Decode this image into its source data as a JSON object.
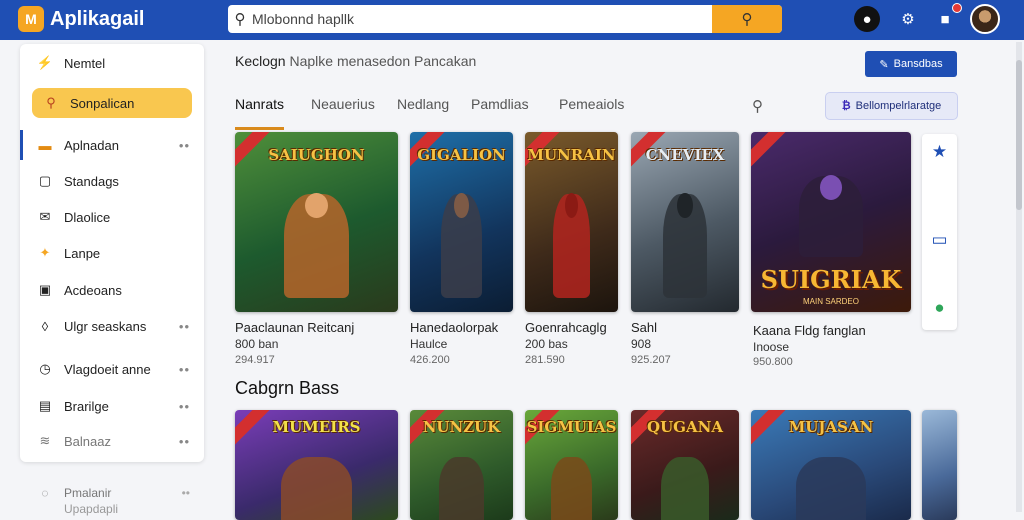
{
  "app": {
    "title": "Aplikagail",
    "logo_mark": "M"
  },
  "search": {
    "value": "Mlobonnd hapllk",
    "placeholder": ""
  },
  "sidebar": {
    "items": [
      {
        "label": "Nemtel",
        "icon": "wand-icon",
        "glyph": "⚡",
        "dots": ""
      },
      {
        "label": "Sonpalican",
        "icon": "search-icon",
        "glyph": "⚲",
        "dots": ""
      },
      {
        "label": "Aplnadan",
        "icon": "briefcase-icon",
        "glyph": "▬",
        "dots": "••"
      },
      {
        "label": "Standags",
        "icon": "document-icon",
        "glyph": "▢",
        "dots": ""
      },
      {
        "label": "Dlaolice",
        "icon": "mail-icon",
        "glyph": "✉",
        "dots": ""
      },
      {
        "label": "Lanpe",
        "icon": "bolt-icon",
        "glyph": "✦",
        "dots": ""
      },
      {
        "label": "Acdeoans",
        "icon": "image-icon",
        "glyph": "▣",
        "dots": ""
      },
      {
        "label": "Ulgr seaskans",
        "icon": "gamepad-icon",
        "glyph": "◊",
        "dots": "••"
      },
      {
        "label": "Vlagdoeit anne",
        "icon": "clock-icon",
        "glyph": "◷",
        "dots": "••"
      },
      {
        "label": "Brarilge",
        "icon": "save-icon",
        "glyph": "▤",
        "dots": "••"
      },
      {
        "label": "Balnaaz",
        "icon": "layers-icon",
        "glyph": "≋",
        "dots": "••"
      }
    ],
    "extra_label": "Pmalanir",
    "extra_label_2": "Upapdapli"
  },
  "main": {
    "subtitle_bold": "Keclogn",
    "subtitle_rest": "Naplke menasedon Pancakan",
    "primary_button": "Bansdbas",
    "tabs": [
      "Nanrats",
      "Neauerius",
      "Nedlang",
      "Pamdlias",
      "Pemeaiols"
    ],
    "chip_label": "Bellompelrlaratge"
  },
  "featured": [
    {
      "art_title": "SAIUGHON",
      "name": "Paaclaunan Reitcanj",
      "sub": "800 ban",
      "stat": "294.917"
    },
    {
      "art_title": "GIGALION",
      "name": "Hanedaolorpak",
      "sub": "Haulce",
      "stat": "426.200"
    },
    {
      "art_title": "MUNRAIN",
      "name": "Goenrahcaglg",
      "sub": "200 bas",
      "stat": "281.590"
    },
    {
      "art_title": "CNEVIEX",
      "name": "Sahl",
      "sub": "908",
      "stat": "925.207"
    },
    {
      "art_title": "SUIGRIAK",
      "art_sub": "MAIN SARDEO",
      "name": "Kaana Fldg fanglan",
      "sub": "Inoose",
      "stat": "950.800"
    }
  ],
  "section": {
    "title": "Cabgrn Bass",
    "cards": [
      {
        "art_title": "MUMEIRS"
      },
      {
        "art_title": "NUNZUK"
      },
      {
        "art_title": "SIGMUIAS"
      },
      {
        "art_title": "QUGANA"
      },
      {
        "art_title": "MUJASAN"
      }
    ]
  },
  "rail": {
    "icons": [
      "star-icon",
      "clipboard-icon",
      "check-circle-icon"
    ]
  },
  "colors": {
    "primary": "#1f4fb4",
    "accent": "#f5a623",
    "ribbon": "#d32f2f"
  }
}
